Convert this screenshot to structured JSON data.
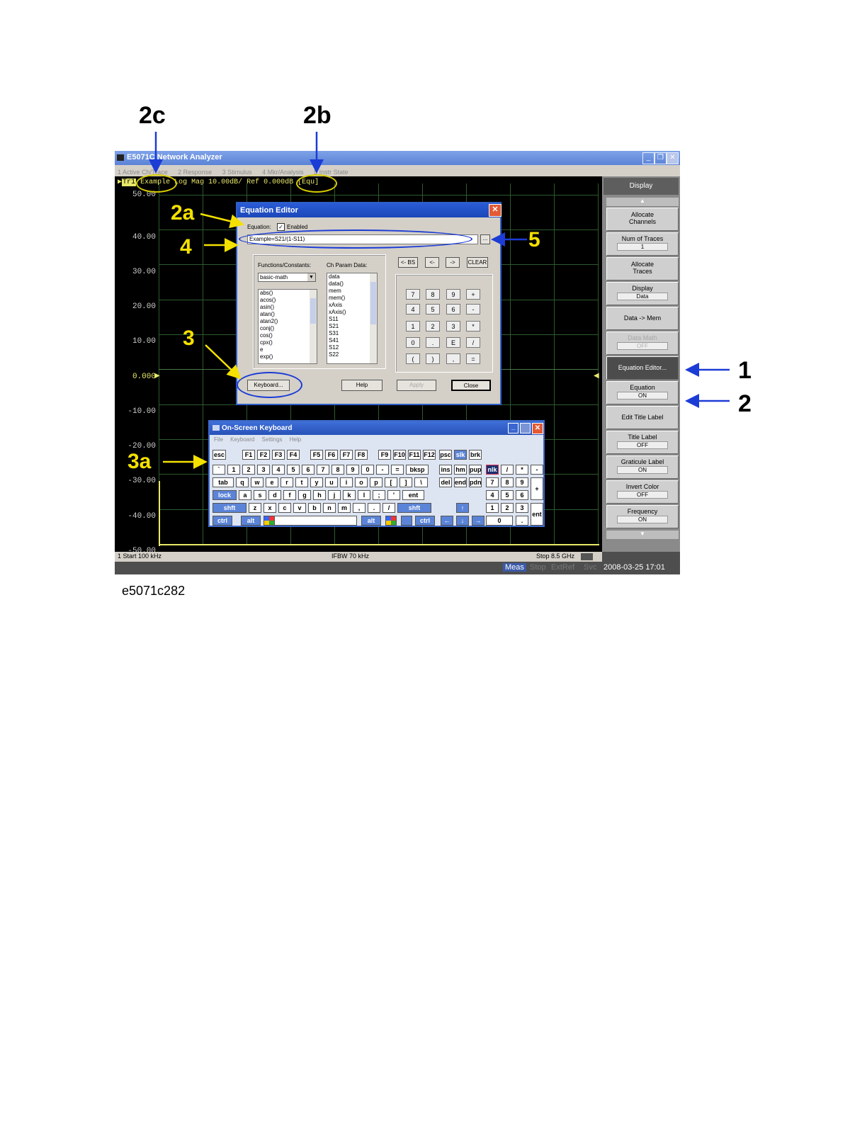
{
  "callouts": {
    "c1": "1",
    "c2": "2",
    "c2a": "2a",
    "c2b": "2b",
    "c2c": "2c",
    "c3": "3",
    "c3a": "3a",
    "c4": "4",
    "c5": "5"
  },
  "caption": "e5071c282",
  "app": {
    "title": "E5071C Network Analyzer",
    "menu": [
      "1 Active Ch/Trace",
      "2 Response",
      "3 Stimulus",
      "4 Mkr/Analysis",
      "5 Instr State"
    ],
    "trace_header": {
      "trace_id": "Tr1",
      "title_label": "Example",
      "format": "Log Mag 10.00dB/ Ref 0.000dB",
      "equation_flag": "[Equ]"
    },
    "y_ticks": [
      "50.00",
      "40.00",
      "30.00",
      "20.00",
      "10.00",
      "0.000",
      "-10.00",
      "-20.00",
      "-30.00",
      "-40.00",
      "-50.00"
    ],
    "status_bar": {
      "start": "1  Start 100 kHz",
      "ifbw": "IFBW 70 kHz",
      "stop": "Stop 8.5 GHz",
      "meas": "Meas",
      "stop_flag": "Stop",
      "extref": "ExtRef",
      "svc": "Svc",
      "datetime": "2008-03-25 17:01"
    }
  },
  "softkeys": {
    "header": "Display",
    "allocate_channels": "Allocate Channels",
    "num_traces": "Num of Traces",
    "num_traces_value": "1",
    "allocate_traces": "Allocate Traces",
    "display": "Display",
    "display_value": "Data",
    "data_mem": "Data -> Mem",
    "data_math": "Data Math",
    "data_math_value": "OFF",
    "equation_editor": "Equation Editor...",
    "equation": "Equation",
    "equation_value": "ON",
    "edit_title_label": "Edit Title Label",
    "title_label": "Title Label",
    "title_label_value": "OFF",
    "graticule_label": "Graticule Label",
    "graticule_label_value": "ON",
    "invert_color": "Invert Color",
    "invert_color_value": "OFF",
    "frequency": "Frequency",
    "frequency_value": "ON"
  },
  "equation_editor": {
    "title": "Equation Editor",
    "equation_label": "Equation:",
    "enabled_label": "Enabled",
    "enabled_checked": "✓",
    "equation_value": "Example=S21/(1-S11)",
    "browse_button": "...",
    "functions_label": "Functions/Constants:",
    "functions_dropdown": "basic-math",
    "functions_list": [
      "abs()",
      "acos()",
      "asin()",
      "atan()",
      "atan2()",
      "conj()",
      "cos()",
      "cpx()",
      "e",
      "exp()"
    ],
    "chparam_label": "Ch Param Data:",
    "chparam_list": [
      "data",
      "data()",
      "mem",
      "mem()",
      "xAxis",
      "xAxis()",
      "S11",
      "S21",
      "S31",
      "S41",
      "S12",
      "S22"
    ],
    "edit_buttons": [
      "<- BS",
      "<-",
      "->",
      "CLEAR"
    ],
    "calc_keys": [
      "7",
      "8",
      "9",
      "+",
      "4",
      "5",
      "6",
      "-",
      "1",
      "2",
      "3",
      "*",
      "0",
      ".",
      "E",
      "/",
      "(",
      ")",
      ",",
      "="
    ],
    "keyboard_button": "Keyboard...",
    "help_button": "Help",
    "apply_button": "Apply",
    "close_button": "Close"
  },
  "osk": {
    "title": "On-Screen Keyboard",
    "menu": [
      "File",
      "Keyboard",
      "Settings",
      "Help"
    ],
    "rows": [
      [
        "esc",
        "F1",
        "F2",
        "F3",
        "F4",
        "F5",
        "F6",
        "F7",
        "F8",
        "F9",
        "F10",
        "F11",
        "F12",
        "psc",
        "slk",
        "brk"
      ],
      [
        "`",
        "1",
        "2",
        "3",
        "4",
        "5",
        "6",
        "7",
        "8",
        "9",
        "0",
        "-",
        "=",
        "bksp",
        "ins",
        "hm",
        "pup",
        "nlk",
        "/",
        "*",
        "-"
      ],
      [
        "tab",
        "q",
        "w",
        "e",
        "r",
        "t",
        "y",
        "u",
        "i",
        "o",
        "p",
        "[",
        "]",
        "\\",
        "del",
        "end",
        "pdn",
        "7",
        "8",
        "9",
        "+"
      ],
      [
        "lock",
        "a",
        "s",
        "d",
        "f",
        "g",
        "h",
        "j",
        "k",
        "l",
        ";",
        "'",
        "ent",
        "4",
        "5",
        "6"
      ],
      [
        "shft",
        "z",
        "x",
        "c",
        "v",
        "b",
        "n",
        "m",
        ",",
        ".",
        "/",
        "shft",
        "↑",
        "1",
        "2",
        "3",
        "ent"
      ],
      [
        "ctrl",
        "alt",
        "alt",
        "ctrl",
        "←",
        "↓",
        "→",
        "0",
        "."
      ]
    ]
  },
  "colors": {
    "annotation_yellow": "#f4e100",
    "annotation_blue": "#1c3cd6",
    "titlebar_blue": "#2a5cd6"
  }
}
